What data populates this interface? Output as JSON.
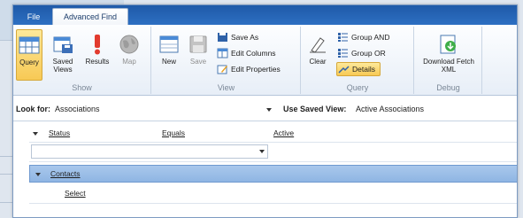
{
  "tabs": {
    "file": "File",
    "advanced_find": "Advanced Find"
  },
  "ribbon": {
    "show": {
      "label": "Show",
      "query": "Query",
      "saved_views": "Saved Views",
      "results": "Results",
      "map": "Map"
    },
    "view": {
      "label": "View",
      "new": "New",
      "save": "Save",
      "save_as": "Save As",
      "edit_columns": "Edit Columns",
      "edit_properties": "Edit Properties"
    },
    "query": {
      "label": "Query",
      "clear": "Clear",
      "group_and": "Group AND",
      "group_or": "Group OR",
      "details": "Details"
    },
    "debug": {
      "label": "Debug",
      "download_fetch": "Download Fetch XML"
    }
  },
  "lookbar": {
    "look_for_label": "Look for:",
    "look_for_value": "Associations",
    "saved_view_label": "Use Saved View:",
    "saved_view_value": "Active Associations"
  },
  "grid": {
    "condition": {
      "field": "Status",
      "operator": "Equals",
      "value": "Active"
    },
    "related_entity": "Contacts",
    "select_placeholder": "Select"
  },
  "colors": {
    "tabbar": "#1f5aa8",
    "active_button": "#f7c955",
    "related_row": "#8fb5e3"
  }
}
